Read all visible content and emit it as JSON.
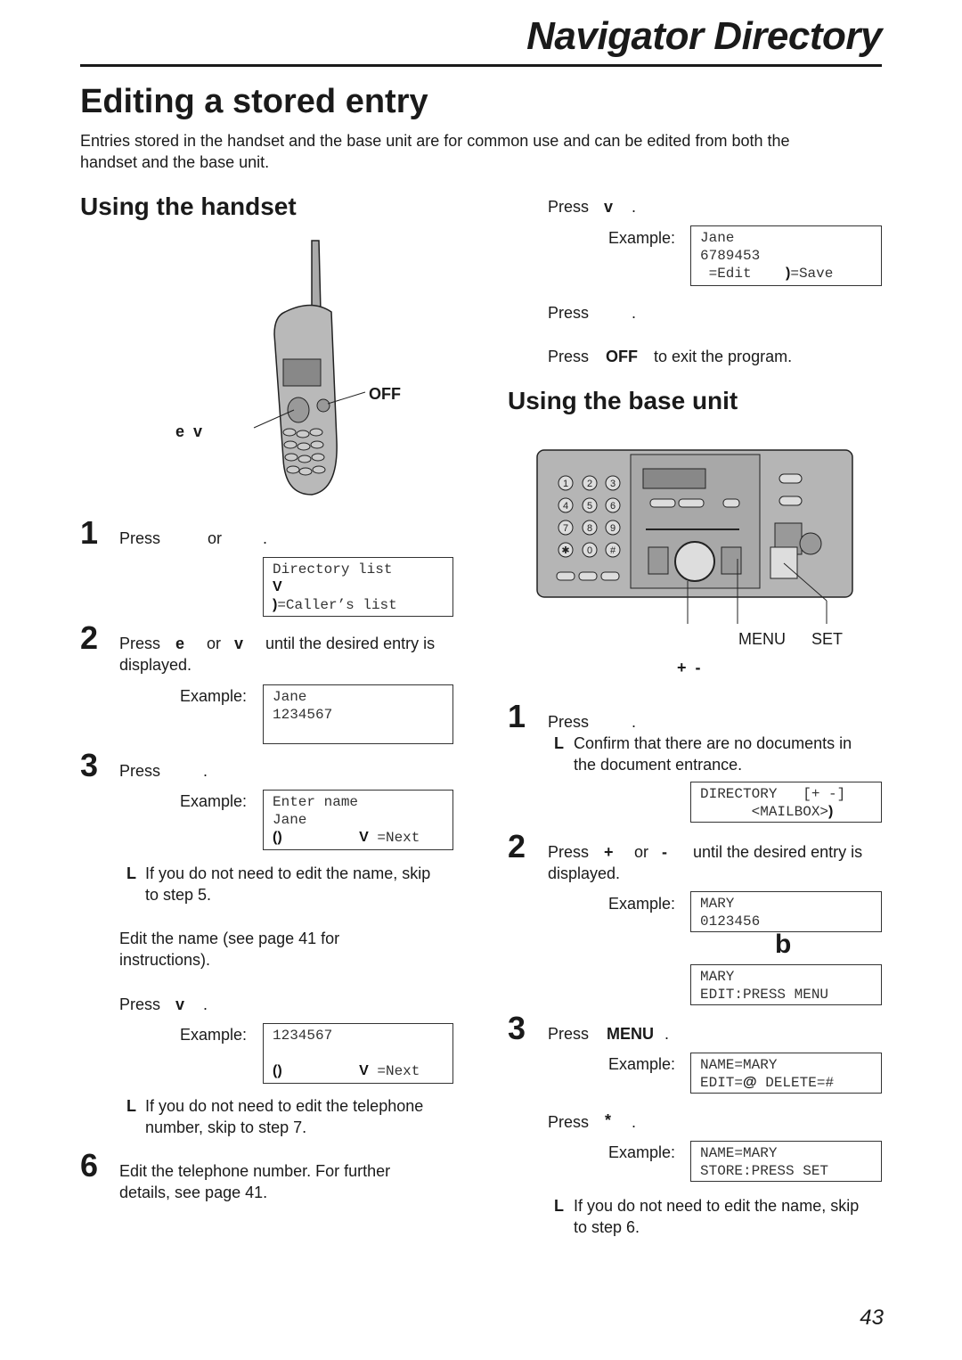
{
  "header": {
    "section": "Navigator Directory",
    "title": "Editing a stored entry",
    "intro": [
      "Entries stored in the handset and the base unit are for common use and can be edited from both the",
      "handset and the base unit."
    ],
    "page_number": "43"
  },
  "handset": {
    "heading": "Using the handset",
    "labels": {
      "off": "OFF",
      "nav": "e  v"
    },
    "step1": {
      "num": "1",
      "press": "Press",
      "or": "or",
      "dot": ".",
      "display": {
        "line1": "Directory list",
        "line2": "V",
        "line3_icon": ")",
        "line3": "=Caller’s list"
      }
    },
    "step2": {
      "num": "2",
      "line1a": "Press",
      "key1": "e",
      "or": "or",
      "key2": "v",
      "line1b": "until the desired entry is",
      "line2": "displayed.",
      "example": "Example:",
      "display": {
        "line1": "Jane",
        "line2": "1234567"
      }
    },
    "step3": {
      "num": "3",
      "press": "Press",
      "dot": ".",
      "example": "Example:",
      "display": {
        "line1": "Enter name",
        "line2": "Jane",
        "line3_left": "()",
        "line3_icon": "V",
        "line3": "=Next"
      }
    },
    "note1": {
      "bullet": "L",
      "line1": "If you do not need to edit the name, skip",
      "line2": "to step 5."
    },
    "step4": {
      "line1": "Edit the name (see page 41 for",
      "line2": "instructions)."
    },
    "step5": {
      "press": "Press",
      "key": "v",
      "dot": ".",
      "example": "Example:",
      "display": {
        "line1": "1234567",
        "line3_left": "()",
        "line3_icon": "V",
        "line3": "=Next"
      }
    },
    "note2": {
      "bullet": "L",
      "line1": "If you do not need to edit the telephone",
      "line2": "number, skip to step 7."
    },
    "step6": {
      "num": "6",
      "line1": "Edit the telephone number. For further",
      "line2": "details, see page 41."
    }
  },
  "handset_cont": {
    "step7": {
      "press": "Press",
      "key": "v",
      "dot": ".",
      "example": "Example:",
      "display": {
        "line1": "Jane",
        "line2": "6789453",
        "line3a": " =Edit",
        "line3_icon": ")",
        "line3b": "=Save"
      }
    },
    "step8": {
      "press": "Press",
      "dot": "."
    },
    "step9": {
      "press": "Press",
      "key": "OFF",
      "rest": "to exit the program."
    }
  },
  "base": {
    "heading": "Using the base unit",
    "labels": {
      "menu": "MENU",
      "set": "SET",
      "plusminus": "+  -"
    },
    "keypad": [
      "1",
      "2",
      "3",
      "4",
      "5",
      "6",
      "7",
      "8",
      "9",
      "✱",
      "0",
      "#"
    ],
    "step1": {
      "num": "1",
      "press": "Press",
      "dot": ".",
      "note_bullet": "L",
      "note1": "Confirm that there are no documents in",
      "note2": "the document entrance.",
      "display": {
        "line1": "DIRECTORY   [+ -]",
        "line2": "      <MAILBOX>",
        "line2_icon": ")"
      }
    },
    "step2": {
      "num": "2",
      "press": "Press",
      "key1": "+",
      "or": "or",
      "key2": "-",
      "rest": "until the desired entry is",
      "line2": "displayed.",
      "example": "Example:",
      "display": {
        "line1": "MARY",
        "line2": "0123456"
      },
      "arrow": "b",
      "display2": {
        "line1": "MARY",
        "line2": "EDIT:PRESS MENU"
      }
    },
    "step3": {
      "num": "3",
      "press": "Press",
      "key": "MENU",
      "dot": ".",
      "example": "Example:",
      "display": {
        "line1": "NAME=MARY",
        "line2a": "EDIT=",
        "line2_icon": "@",
        "line2b": " DELETE=#"
      }
    },
    "step4": {
      "press": "Press",
      "key": "*",
      "dot": ".",
      "example": "Example:",
      "display": {
        "line1": "NAME=MARY",
        "line2": "STORE:PRESS SET"
      }
    },
    "note": {
      "bullet": "L",
      "line1": "If you do not need to edit the name, skip",
      "line2": "to step 6."
    }
  }
}
